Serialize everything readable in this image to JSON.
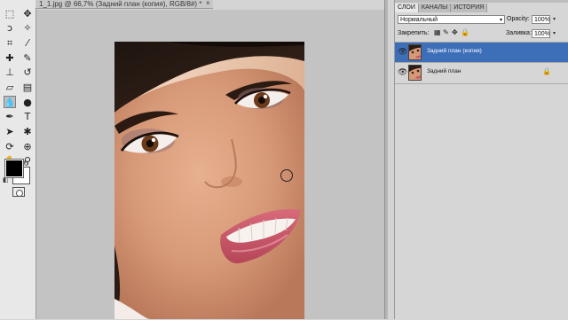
{
  "document": {
    "tab_title": "1_1.jpg @ 66,7% (Задний план (копия), RGB/8#) *",
    "close_glyph": "×"
  },
  "toolbar": {
    "tools": [
      {
        "name": "rect-marquee-icon",
        "glyph": "⬚"
      },
      {
        "name": "move-icon",
        "glyph": "✥"
      },
      {
        "name": "lasso-icon",
        "glyph": "ↄ"
      },
      {
        "name": "quick-select-icon",
        "glyph": "✧"
      },
      {
        "name": "crop-icon",
        "glyph": "⌗"
      },
      {
        "name": "eyedropper-icon",
        "glyph": "⁄"
      },
      {
        "name": "healing-brush-icon",
        "glyph": "✚"
      },
      {
        "name": "brush-icon",
        "glyph": "✎"
      },
      {
        "name": "clone-stamp-icon",
        "glyph": "⊥"
      },
      {
        "name": "history-brush-icon",
        "glyph": "↺"
      },
      {
        "name": "eraser-icon",
        "glyph": "▱"
      },
      {
        "name": "gradient-icon",
        "glyph": "▤"
      },
      {
        "name": "blur-icon",
        "glyph": "💧",
        "selected": true
      },
      {
        "name": "dodge-icon",
        "glyph": "●"
      },
      {
        "name": "pen-icon",
        "glyph": "✒"
      },
      {
        "name": "type-icon",
        "glyph": "T"
      },
      {
        "name": "path-select-icon",
        "glyph": "➤"
      },
      {
        "name": "shape-icon",
        "glyph": "✱"
      },
      {
        "name": "3d-rotate-icon",
        "glyph": "⟳"
      },
      {
        "name": "3d-orbit-icon",
        "glyph": "⊕"
      },
      {
        "name": "hand-icon",
        "glyph": "✋"
      },
      {
        "name": "zoom-icon",
        "glyph": "⚲"
      }
    ],
    "swap_glyph": "↻",
    "reset_glyph": "◧",
    "foreground_color": "#000000",
    "background_color": "#ffffff"
  },
  "layers_panel": {
    "tabs": [
      {
        "label": "СЛОИ",
        "active": true
      },
      {
        "label": "КАНАЛЫ",
        "active": false
      },
      {
        "label": "ИСТОРИЯ",
        "active": false
      }
    ],
    "blend_mode": "Нормальный",
    "opacity_label": "Opacity:",
    "opacity_value": "100%",
    "lock_label": "Закрепить:",
    "fill_label": "Заливка:",
    "fill_value": "100%",
    "lock_icons": [
      "▦",
      "✎",
      "✥",
      "🔒"
    ],
    "dropdown_glyph": "▾",
    "eye_glyph": "👁",
    "layer_lock_glyph": "🔒",
    "layers": [
      {
        "name": "Задний план (копия)",
        "selected": true,
        "locked": false
      },
      {
        "name": "Задний план",
        "selected": false,
        "locked": true
      }
    ]
  },
  "colors": {
    "selected_layer": "#3d6fb9",
    "canvas_bg": "#c3c3c3"
  }
}
